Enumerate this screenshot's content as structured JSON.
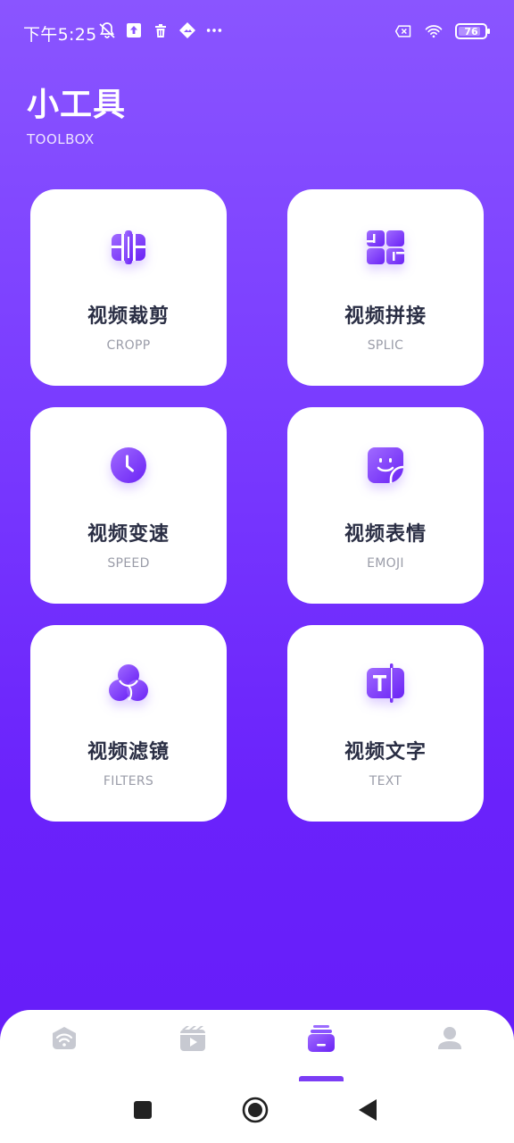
{
  "status_bar": {
    "time": "下午5:25",
    "left_icons": [
      "muted-bell-icon",
      "upload-icon",
      "trash-icon",
      "image-icon",
      "more-dots-icon"
    ],
    "right_icons": [
      "sim-x-icon",
      "wifi-icon"
    ],
    "battery_level": "76"
  },
  "header": {
    "title": "小工具",
    "subtitle": "TOOLBOX"
  },
  "tools": [
    {
      "title": "视频裁剪",
      "subtitle": "CROPP",
      "icon": "crop-icon"
    },
    {
      "title": "视频拼接",
      "subtitle": "SPLIC",
      "icon": "splice-icon"
    },
    {
      "title": "视频变速",
      "subtitle": "SPEED",
      "icon": "clock-icon"
    },
    {
      "title": "视频表情",
      "subtitle": "EMOJI",
      "icon": "sticker-face-icon"
    },
    {
      "title": "视频滤镜",
      "subtitle": "FILTERS",
      "icon": "filters-icon"
    },
    {
      "title": "视频文字",
      "subtitle": "TEXT",
      "icon": "text-icon"
    }
  ],
  "bottom_nav": {
    "items": [
      "wifi-home-icon",
      "video-clapper-icon",
      "toolbox-icon",
      "profile-icon"
    ],
    "active_index": 2
  },
  "colors": {
    "accent": "#7b3df5",
    "background_top": "#8a55ff",
    "background_bottom": "#651bf8",
    "icon_inactive": "#c7c9d1",
    "card_title": "#2a2e44",
    "card_subtitle": "#9a9ca8"
  }
}
